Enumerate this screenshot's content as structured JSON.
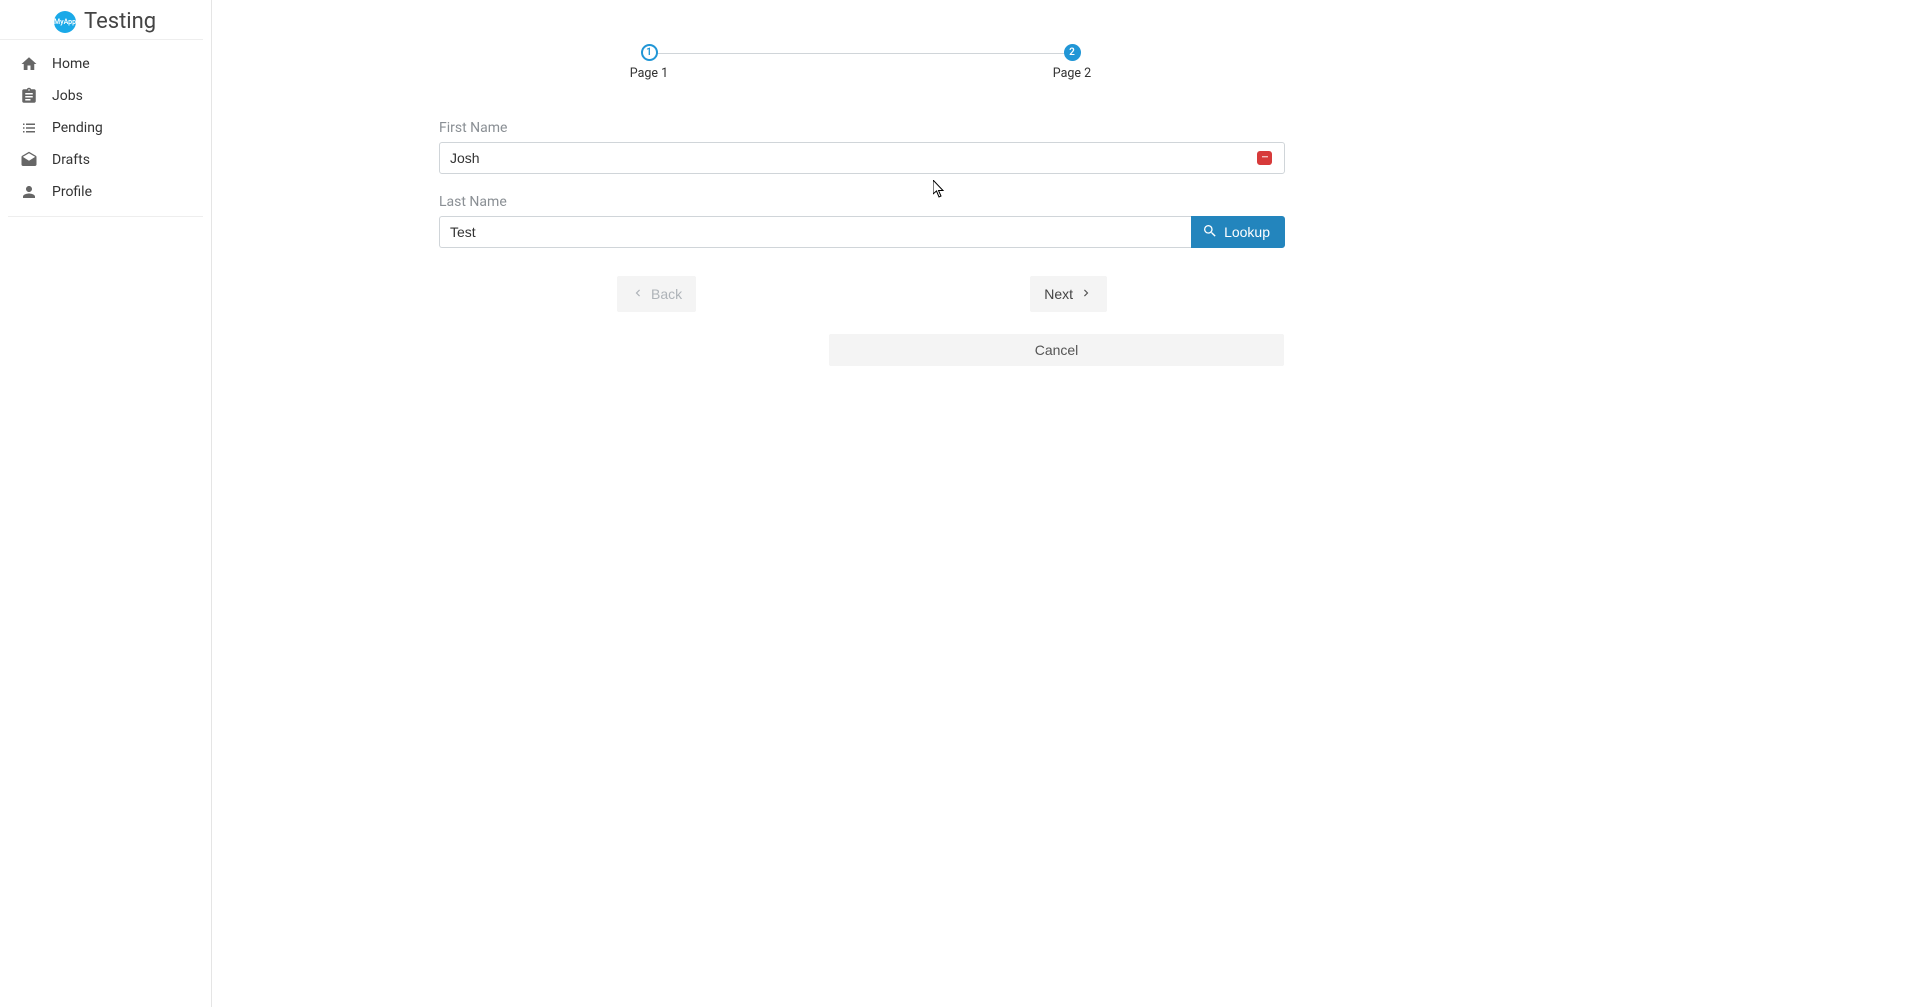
{
  "app": {
    "logo_text": "MyApp",
    "title": "Testing"
  },
  "sidebar": {
    "items": [
      {
        "label": "Home"
      },
      {
        "label": "Jobs"
      },
      {
        "label": "Pending"
      },
      {
        "label": "Drafts"
      },
      {
        "label": "Profile"
      }
    ]
  },
  "stepper": {
    "steps": [
      {
        "number": "1",
        "label": "Page 1"
      },
      {
        "number": "2",
        "label": "Page 2"
      }
    ]
  },
  "form": {
    "first_name": {
      "label": "First Name",
      "value": "Josh"
    },
    "last_name": {
      "label": "Last Name",
      "value": "Test"
    },
    "lookup_label": "Lookup"
  },
  "buttons": {
    "back": "Back",
    "next": "Next",
    "cancel": "Cancel"
  }
}
